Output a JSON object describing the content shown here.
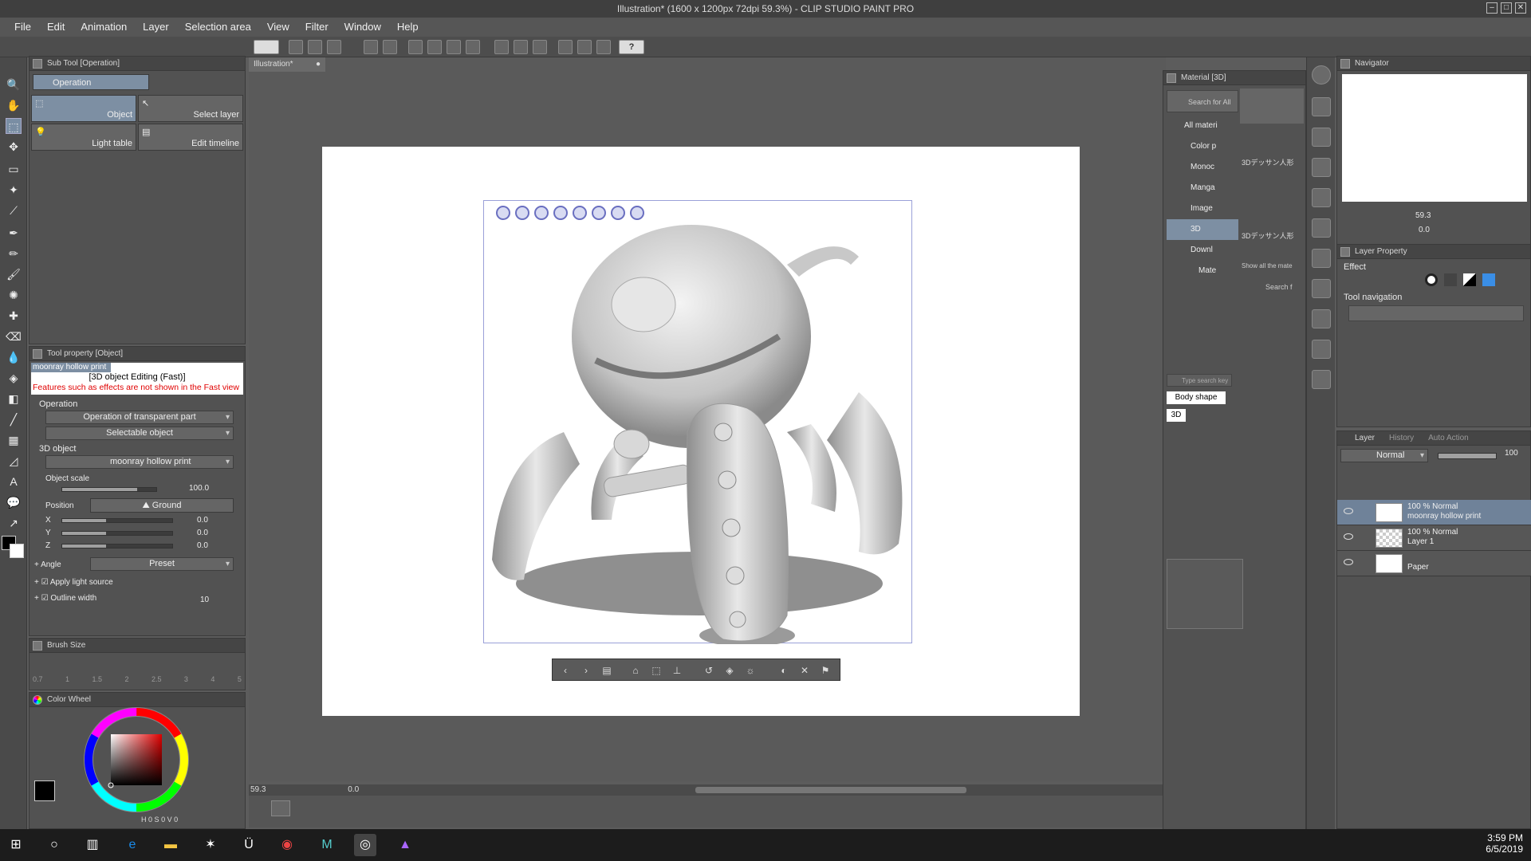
{
  "window": {
    "title": "Illustration* (1600 x 1200px 72dpi 59.3%) - CLIP STUDIO PAINT PRO",
    "buttons": [
      "–",
      "□",
      "✕"
    ]
  },
  "menu": [
    "File",
    "Edit",
    "Animation",
    "Layer",
    "Selection area",
    "View",
    "Filter",
    "Window",
    "Help"
  ],
  "toolbar": {
    "help_label": "?"
  },
  "document": {
    "tab_label": "Illustration*"
  },
  "subtool": {
    "header": "Sub Tool [Operation]",
    "group_label": "Operation",
    "items": [
      "Object",
      "Select layer",
      "Light table",
      "Edit timeline"
    ]
  },
  "tool_property": {
    "header": "Tool property [Object]",
    "object_name_banner": "moonray hollow print",
    "mode_text": "[3D object Editing (Fast)]",
    "warning": "Features such as effects are not shown in the Fast view",
    "operation_label": "Operation",
    "transparent_part": "Operation of transparent part",
    "selectable_object": "Selectable object",
    "object_section": "3D object",
    "object_name": "moonray hollow print",
    "object_scale_label": "Object scale",
    "object_scale_value": "100.0",
    "position_label": "Position",
    "position_mode": "Ground",
    "x_label": "X",
    "x_value": "0.0",
    "y_label": "Y",
    "y_value": "0.0",
    "z_label": "Z",
    "z_value": "0.0",
    "angle_label": "Angle",
    "angle_preset": "Preset",
    "apply_light": "Apply light source",
    "outline_width": "Outline width",
    "outline_value": "10"
  },
  "brush_size": {
    "header": "Brush Size",
    "sizes": [
      "0.7",
      "1",
      "1.5",
      "2",
      "2.5",
      "3",
      "4",
      "5"
    ]
  },
  "color_wheel": {
    "header": "Color Wheel",
    "h_label": "H",
    "h_value": "0",
    "s_label": "S",
    "s_value": "0",
    "v_label": "V",
    "v_value": "0",
    "main_color": "#000000",
    "sub_color": "#ffffff"
  },
  "canvas_status": {
    "zoom": "59.3",
    "angle": "0.0"
  },
  "material": {
    "header": "Material [3D]",
    "search_label": "Search for All",
    "tree": [
      "All materi",
      "Color p",
      "Monoc",
      "Manga",
      "Image",
      "3D",
      "Downl",
      "Mate"
    ],
    "thumbs": [
      "3Dデッサン人形",
      "3Dデッサン人形"
    ],
    "show_all": "Show all the mate",
    "search_small": "Search f",
    "tag_search_placeholder": "Type search key",
    "tags": [
      "Body shape",
      "3D"
    ]
  },
  "navigator": {
    "header": "Navigator",
    "zoom": "59.3",
    "angle": "0.0"
  },
  "layer_property": {
    "header": "Layer Property",
    "effect_label": "Effect",
    "tool_nav_label": "Tool navigation"
  },
  "layers": {
    "tabs": [
      "Layer",
      "History",
      "Auto Action"
    ],
    "blend_mode": "Normal",
    "opacity": "100",
    "rows": [
      {
        "line1": "100 % Normal",
        "line2": "moonray hollow print"
      },
      {
        "line1": "100 % Normal",
        "line2": "Layer 1"
      },
      {
        "line1": "",
        "line2": "Paper"
      }
    ]
  },
  "taskbar": {
    "time": "3:59 PM",
    "date": "6/5/2019"
  }
}
